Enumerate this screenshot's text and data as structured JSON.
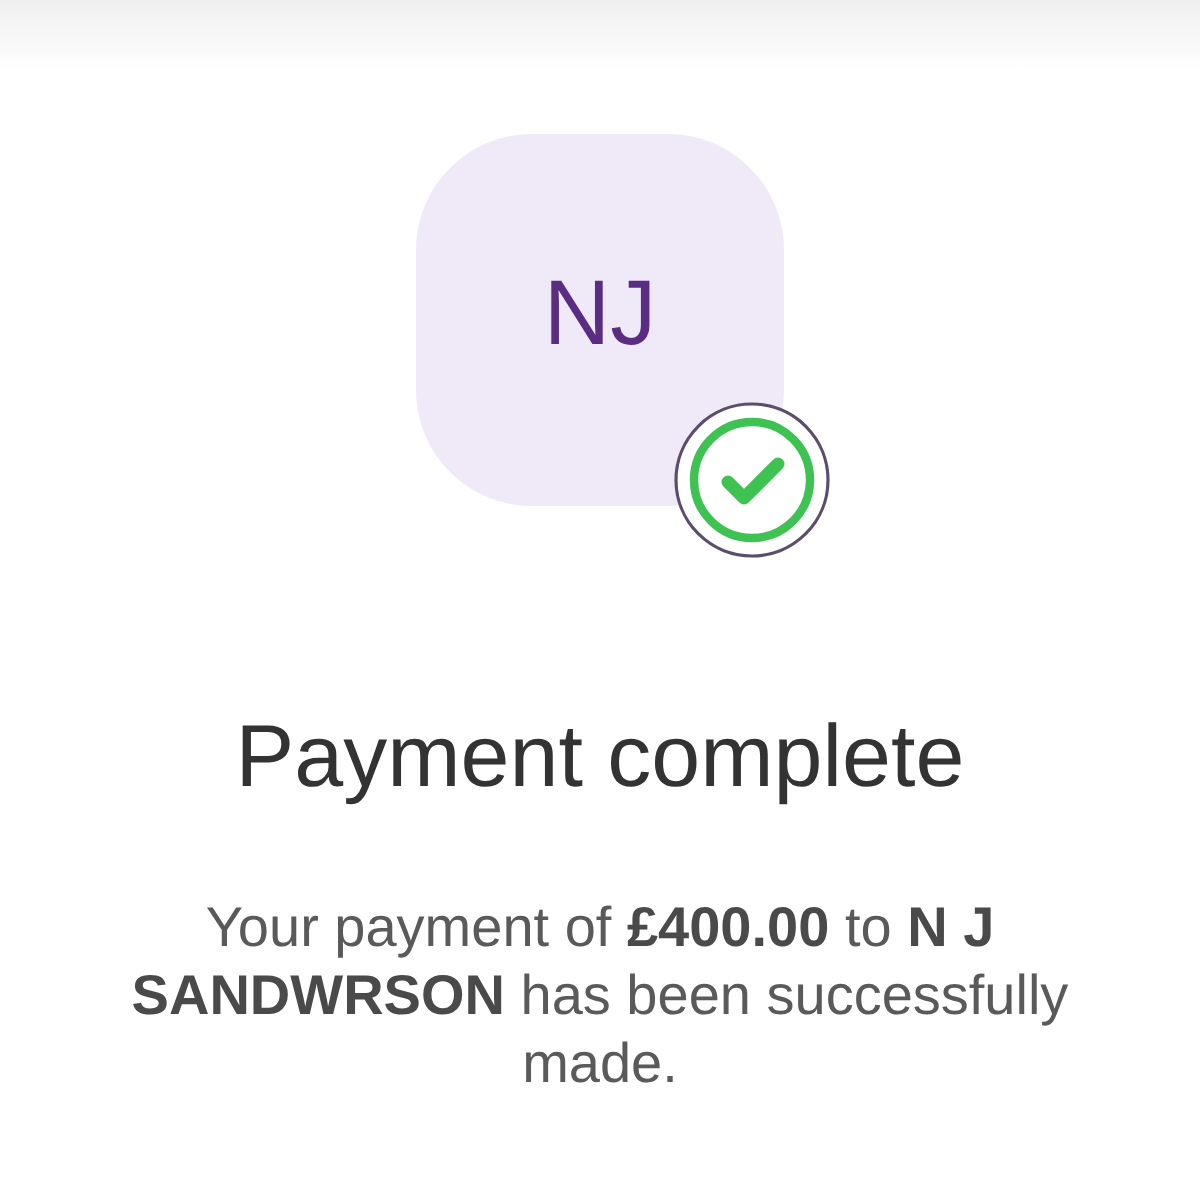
{
  "recipient": {
    "initials": "NJ",
    "verified": true
  },
  "title": "Payment complete",
  "message": "Your payment of **£400.00** to **N J SANDWRSON** has been successfully made."
}
